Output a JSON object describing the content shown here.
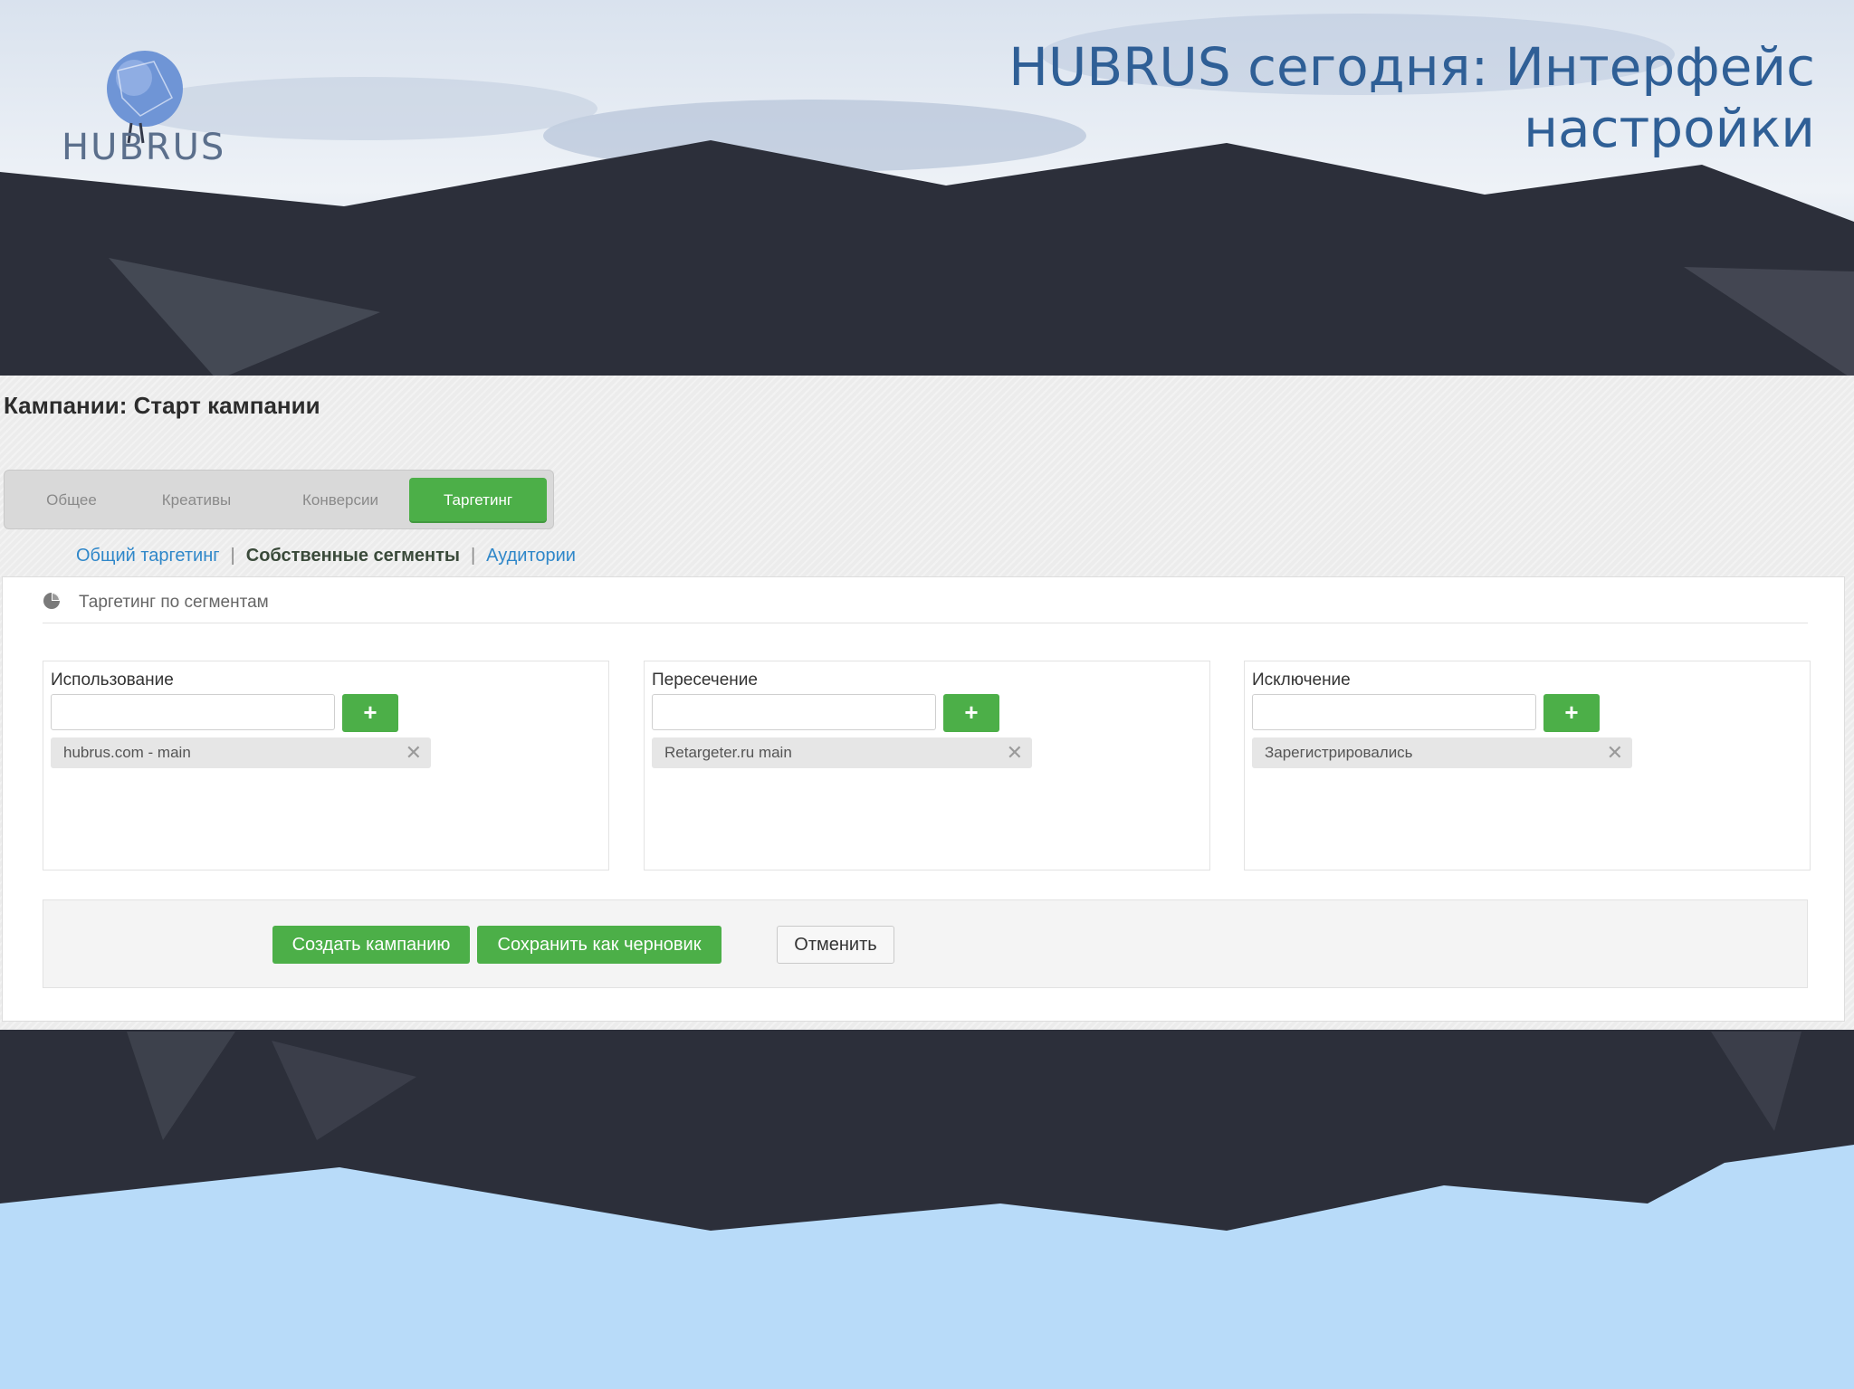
{
  "slide": {
    "logo_text": "HUBRUS",
    "title_line1": "HUBRUS сегодня: Интерфейс",
    "title_line2": "настройки"
  },
  "app": {
    "page_title": "Кампании: Старт кампании",
    "tabs": [
      {
        "label": "Общее",
        "active": false
      },
      {
        "label": "Креативы",
        "active": false
      },
      {
        "label": "Конверсии",
        "active": false
      },
      {
        "label": "Таргетинг",
        "active": true
      }
    ],
    "subnav": {
      "general": "Общий таргетинг",
      "own_segments": "Собственные сегменты",
      "audiences": "Аудитории",
      "separator": "|"
    },
    "panel": {
      "heading": "Таргетинг по сегментам",
      "heading_icon": "pie-chart-icon"
    },
    "columns": [
      {
        "label": "Использование",
        "input_value": "",
        "add_label": "+",
        "chip": "hubrus.com - main",
        "remove": "✕"
      },
      {
        "label": "Пересечение",
        "input_value": "",
        "add_label": "+",
        "chip": "Retargeter.ru main",
        "remove": "✕"
      },
      {
        "label": "Исключение",
        "input_value": "",
        "add_label": "+",
        "chip": "Зарегистрировались",
        "remove": "✕"
      }
    ],
    "actions": {
      "create": "Создать кампанию",
      "save_draft": "Сохранить как черновик",
      "cancel": "Отменить"
    }
  },
  "colors": {
    "accent_green": "#4caf48",
    "link_blue": "#2f87c9",
    "title_blue": "#2f5f96",
    "mountain_dark": "#2c2f3a",
    "sky_light": "#b8dbf9"
  }
}
